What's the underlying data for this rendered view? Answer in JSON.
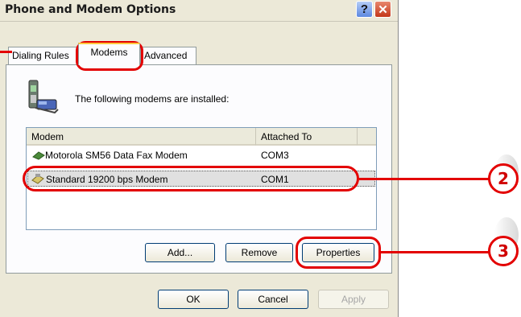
{
  "window": {
    "title": "Phone and Modem Options"
  },
  "tabs": [
    {
      "label": "Dialing Rules",
      "active": false
    },
    {
      "label": "Modems",
      "active": true
    },
    {
      "label": "Advanced",
      "active": false
    }
  ],
  "modems_tab": {
    "info_text": "The following modems are  installed:",
    "columns": [
      "Modem",
      "Attached To"
    ],
    "rows": [
      {
        "modem": "Motorola SM56 Data Fax Modem",
        "attached_to": "COM3",
        "selected": false
      },
      {
        "modem": "Standard 19200 bps Modem",
        "attached_to": "COM1",
        "selected": true
      }
    ],
    "buttons": {
      "add": "Add...",
      "remove": "Remove",
      "properties": "Properties"
    }
  },
  "footer": {
    "ok": "OK",
    "cancel": "Cancel",
    "apply": "Apply"
  },
  "annotations": {
    "step2": "2",
    "step3": "3",
    "highlight_color": "#e30000"
  },
  "icons": {
    "help": "question-mark-icon",
    "close": "close-x-icon",
    "phone": "phone-modem-icon",
    "modem_row": "modem-icon"
  }
}
